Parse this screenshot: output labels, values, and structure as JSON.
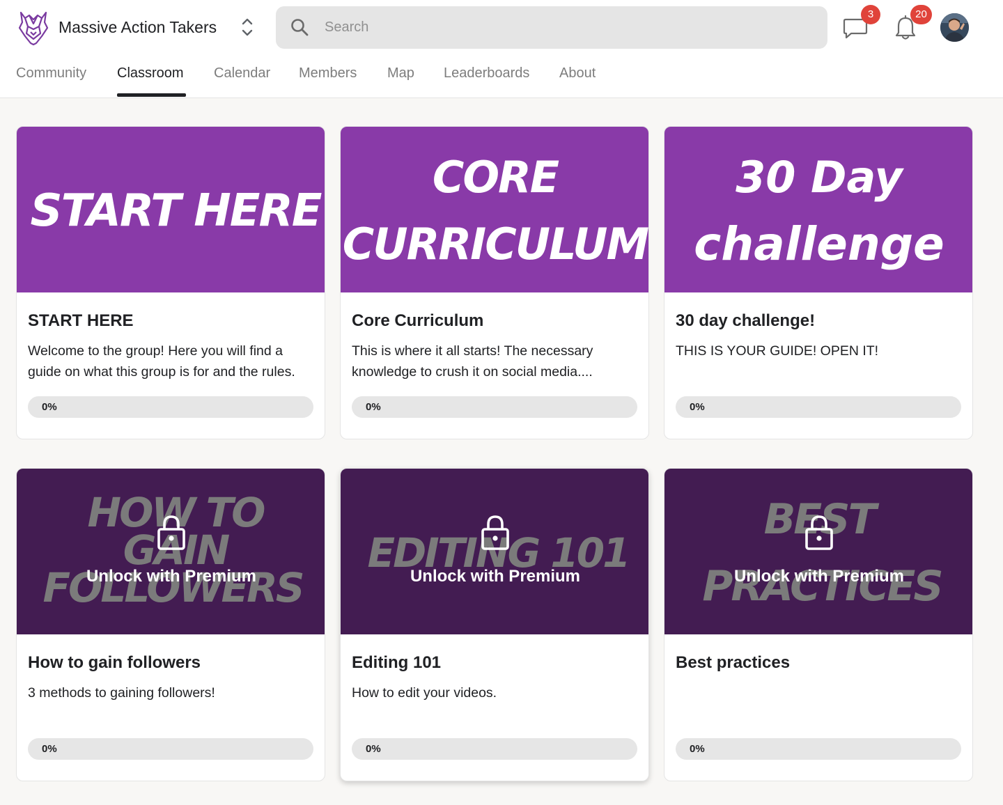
{
  "header": {
    "group_name": "Massive Action Takers",
    "search_placeholder": "Search",
    "chat_badge": "3",
    "notification_badge": "20",
    "accent_color": "#893aa8",
    "badge_color": "#e0433a"
  },
  "tabs": [
    {
      "label": "Community",
      "active": false
    },
    {
      "label": "Classroom",
      "active": true
    },
    {
      "label": "Calendar",
      "active": false
    },
    {
      "label": "Members",
      "active": false
    },
    {
      "label": "Map",
      "active": false
    },
    {
      "label": "Leaderboards",
      "active": false
    },
    {
      "label": "About",
      "active": false
    }
  ],
  "courses": [
    {
      "cover_lines": [
        "START HERE"
      ],
      "title": "START HERE",
      "description": "Welcome to the group! Here you will find a guide on what this group is for and the rules.",
      "progress": 0,
      "progress_label": "0%",
      "locked": false
    },
    {
      "cover_lines": [
        "CORE",
        "CURRICULUM"
      ],
      "title": "Core Curriculum",
      "description": "This is where it all starts! The necessary knowledge to crush it on social media....",
      "progress": 0,
      "progress_label": "0%",
      "locked": false
    },
    {
      "cover_lines": [
        "30 Day",
        "challenge"
      ],
      "title": "30 day challenge!",
      "description": "THIS IS YOUR GUIDE! OPEN IT!",
      "progress": 0,
      "progress_label": "0%",
      "locked": false
    },
    {
      "cover_lines": [
        "HOW TO",
        "GAIN",
        "FOLLOWERS"
      ],
      "title": "How to gain followers",
      "description": "3 methods to gaining followers!",
      "progress": 0,
      "progress_label": "0%",
      "locked": true,
      "lock_label": "Unlock with Premium"
    },
    {
      "cover_lines": [
        "EDITING 101"
      ],
      "title": "Editing 101",
      "description": "How to edit your videos.",
      "progress": 0,
      "progress_label": "0%",
      "locked": true,
      "lock_label": "Unlock with Premium"
    },
    {
      "cover_lines": [
        "BEST",
        "PRACTICES"
      ],
      "title": "Best practices",
      "description": "",
      "progress": 0,
      "progress_label": "0%",
      "locked": true,
      "lock_label": "Unlock with Premium"
    }
  ]
}
